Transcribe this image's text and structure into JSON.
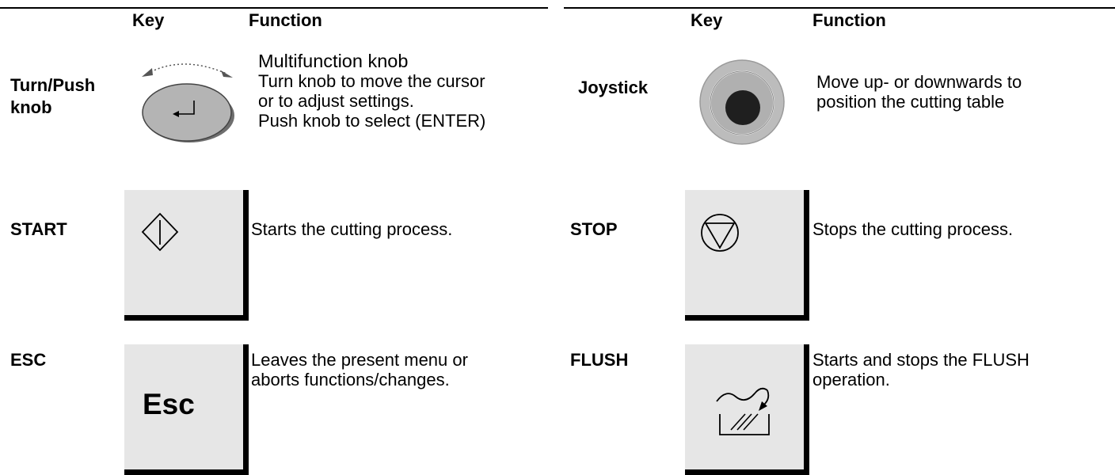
{
  "headers": {
    "left_key": "Key",
    "left_function": "Function",
    "right_key": "Key",
    "right_function": "Function"
  },
  "rows": {
    "turn_push": {
      "label_lines": [
        "Turn/Push",
        "knob"
      ],
      "function_lines": [
        "Multifunction knob",
        "Turn knob to move the cursor",
        "or to adjust settings.",
        "Push knob to select (ENTER)"
      ],
      "icon": "enter-arrow-icon"
    },
    "joystick": {
      "label": "Joystick",
      "function_lines": [
        "Move up- or downwards to",
        "position the cutting table"
      ],
      "icon": "joystick-icon"
    },
    "start": {
      "label": "START",
      "function": "Starts the cutting process.",
      "icon": "start-diamond-icon"
    },
    "stop": {
      "label": "STOP",
      "function": "Stops the cutting process.",
      "icon": "stop-triangle-icon"
    },
    "esc": {
      "label": "ESC",
      "key_text": "Esc",
      "function_lines": [
        "Leaves the present menu or",
        "aborts functions/changes."
      ]
    },
    "flush": {
      "label": "FLUSH",
      "function_lines": [
        "Starts and stops the FLUSH",
        "operation."
      ],
      "icon": "flush-icon"
    }
  },
  "colors": {
    "key_background": "#e6e6e6",
    "knob_fill": "#b4b4b4",
    "joystick_fill": "#bcbcbc",
    "ink": "#000000"
  }
}
